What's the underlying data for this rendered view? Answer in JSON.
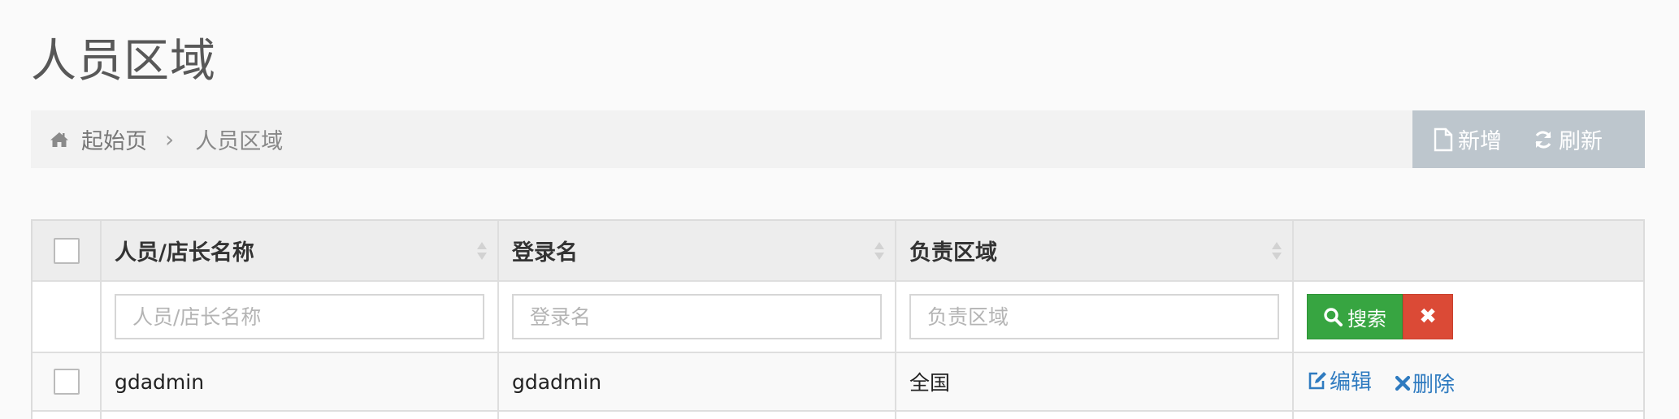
{
  "page": {
    "title": "人员区域"
  },
  "breadcrumb": {
    "home_icon": "home-icon",
    "home_label": "起始页",
    "separator": "›",
    "current": "人员区域"
  },
  "toolbar": {
    "add_icon": "file-icon",
    "add_label": "新增",
    "refresh_icon": "refresh-icon",
    "refresh_label": "刷新"
  },
  "table": {
    "columns": [
      "人员/店长名称",
      "登录名",
      "负责区域"
    ],
    "filters": {
      "name_placeholder": "人员/店长名称",
      "login_placeholder": "登录名",
      "area_placeholder": "负责区域"
    },
    "search_label": "搜索",
    "clear_label": "✖",
    "rows": [
      {
        "name": "gdadmin",
        "login": "gdadmin",
        "area": "全国",
        "edit_label": "编辑",
        "delete_label": "删除"
      }
    ]
  },
  "colors": {
    "toolbar_bg": "#bdc6cd",
    "search_btn": "#37a541",
    "clear_btn": "#db4a36",
    "link": "#2f7bc0"
  }
}
